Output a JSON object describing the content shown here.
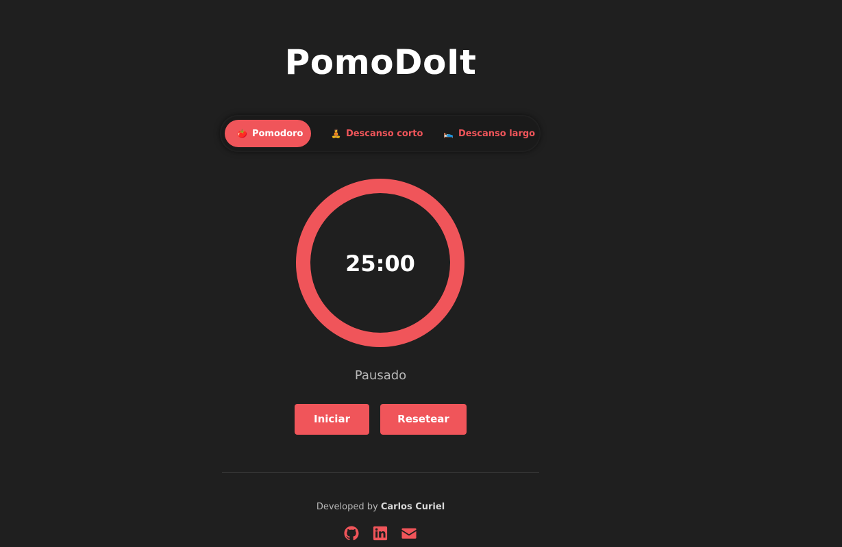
{
  "app": {
    "title": "PomoDoIt"
  },
  "modes": [
    {
      "label": "Pomodoro",
      "emoji": "🍅",
      "active": true
    },
    {
      "label": "Descanso corto",
      "emoji": "🧘",
      "active": false
    },
    {
      "label": "Descanso largo",
      "emoji": "🛌",
      "active": false
    }
  ],
  "timer": {
    "time": "25:00",
    "status": "Pausado",
    "progress": 1.0
  },
  "actions": {
    "start_label": "Iniciar",
    "reset_label": "Resetear"
  },
  "footer": {
    "prefix": "Developed by",
    "author": "Carlos Curiel",
    "socials": [
      "github-icon",
      "linkedin-icon",
      "email-icon"
    ]
  },
  "colors": {
    "accent": "#f0555a",
    "background": "#1f1f1f"
  }
}
